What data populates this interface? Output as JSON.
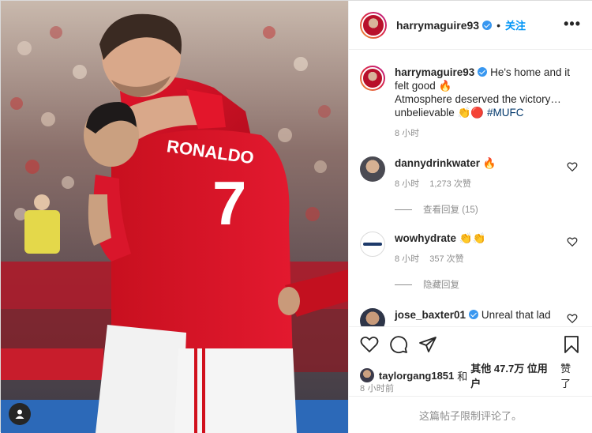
{
  "post": {
    "username": "harrymaguire93",
    "separator": "•",
    "follow_label": "关注",
    "more_label": "•••"
  },
  "caption": {
    "username": "harrymaguire93",
    "line1": "He's home and it felt good",
    "emoji1": "🔥",
    "line2": "Atmosphere deserved the victory… unbelievable",
    "emoji2": "👏",
    "emoji3": "🔴",
    "hashtag": "#MUFC",
    "time": "8 小时"
  },
  "comments": [
    {
      "username": "dannydrinkwater",
      "text": "🔥",
      "time": "8 小时",
      "likes": "1,273 次赞",
      "reply_toggle": "查看回复 (15)"
    },
    {
      "username": "wowhydrate",
      "text": "👏👏",
      "time": "8 小时",
      "likes": "357 次赞",
      "reply_toggle": "隐藏回复"
    },
    {
      "username": "jose_baxter01",
      "text": "Unreal that lad"
    }
  ],
  "likes_line": {
    "user": "taylorgang1851",
    "and": "和",
    "others": "其他 47.7万 位用户",
    "suffix": "赞了"
  },
  "post_time": "8 小时前",
  "comments_limited": "这篇帖子限制评论了。",
  "photo": {
    "shirt_number": "7",
    "shirt_name": "RONALDO"
  },
  "colors": {
    "accent": "#0095f6",
    "verified": "#3897f0",
    "muted": "#8e8e8e",
    "united_red": "#d1101d"
  }
}
